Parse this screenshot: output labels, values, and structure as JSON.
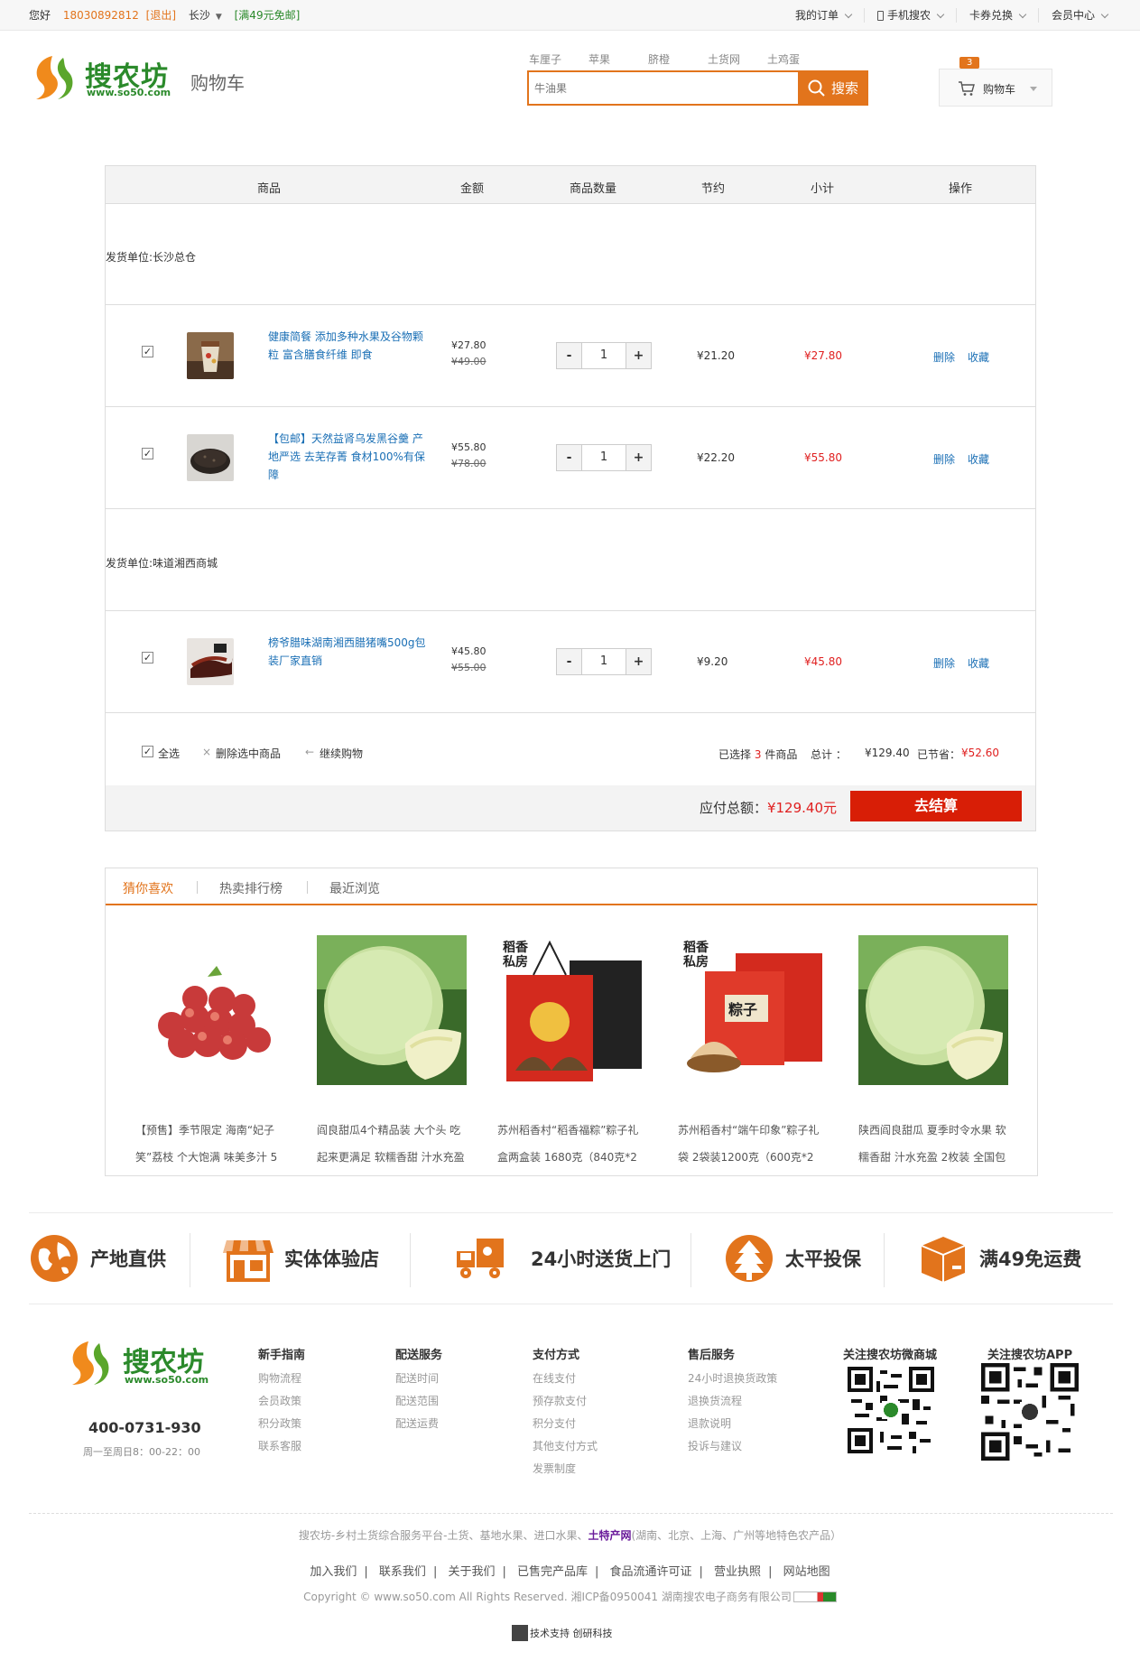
{
  "topbar": {
    "greeting": "您好",
    "phone": "18030892812",
    "logout": "[退出]",
    "city": "长沙",
    "promo": "[满49元免邮]",
    "menu": [
      "我的订单",
      "手机搜农",
      "卡券兑换",
      "会员中心"
    ]
  },
  "header": {
    "brand": "搜农坊",
    "brand_url": "www.so50.com",
    "page_name": "购物车",
    "hot_words": [
      "车厘子",
      "苹果",
      "脐橙",
      "土货网",
      "土鸡蛋"
    ],
    "search_placeholder": "牛油果",
    "search_button": "搜索",
    "cart_count": "3",
    "cart_label": "购物车"
  },
  "cart": {
    "columns": [
      "商品",
      "金额",
      "商品数量",
      "节约",
      "小计",
      "操作"
    ],
    "shops": [
      {
        "label": "发货单位:长沙总仓"
      },
      {
        "label": "发货单位:味道湘西商城"
      }
    ],
    "items": [
      {
        "checked": "✓",
        "name": "健康简餐 添加多种水果及谷物颗粒 富含膳食纤维 即食",
        "price": "¥27.80",
        "orig_price": "¥49.00",
        "qty": "1",
        "save": "¥21.20",
        "subtotal": "¥27.80",
        "op_delete": "删除",
        "op_fav": "收藏"
      },
      {
        "checked": "✓",
        "name": "【包邮】天然益肾乌发黑谷羹 产地严选 去芜存菁 食材100%有保障",
        "price": "¥55.80",
        "orig_price": "¥78.00",
        "qty": "1",
        "save": "¥22.20",
        "subtotal": "¥55.80",
        "op_delete": "删除",
        "op_fav": "收藏"
      },
      {
        "checked": "✓",
        "name": "榜爷腊味湖南湘西腊猪嘴500g包装厂家直销",
        "price": "¥45.80",
        "orig_price": "¥55.00",
        "qty": "1",
        "save": "¥9.20",
        "subtotal": "¥45.80",
        "op_delete": "删除",
        "op_fav": "收藏"
      }
    ],
    "qty_minus": "-",
    "qty_plus": "+",
    "select_all": "全选",
    "delete_selected": "删除选中商品",
    "continue_shopping": "继续购物",
    "selected_prefix": "已选择",
    "selected_count": "3",
    "selected_suffix": "件商品",
    "total_label": "总计 ：",
    "total": "¥129.40",
    "saved_label": "已节省：",
    "saved": "¥52.60",
    "payable_label": "应付总额：",
    "payable": "¥129.40元",
    "checkout": "去结算"
  },
  "recommend": {
    "tabs": [
      "猜你喜欢",
      "热卖排行榜",
      "最近浏览"
    ],
    "items": [
      {
        "title": "【预售】季节限定 海南“妃子笑”荔枝 个大饱满 味美多汁 5"
      },
      {
        "title": "阎良甜瓜4个精品装 大个头 吃起来更满足 软糯香甜 汁水充盈"
      },
      {
        "title": "苏州稻香村“稻香福粽”粽子礼盒两盒装 1680克（840克*2"
      },
      {
        "title": "苏州稻香村“端午印象”粽子礼袋 2袋装1200克（600克*2"
      },
      {
        "title": "陕西阎良甜瓜 夏季时令水果 软糯香甜 汁水充盈 2枚装 全国包"
      }
    ]
  },
  "features": [
    "产地直供",
    "实体体验店",
    "24小时送货上门",
    "太平投保",
    "满49免运费"
  ],
  "footer": {
    "phone": "400-0731-930",
    "hours": "周一至周日8：00-22：00",
    "columns": [
      {
        "title": "新手指南",
        "items": [
          "购物流程",
          "会员政策",
          "积分政策",
          "联系客服"
        ]
      },
      {
        "title": "配送服务",
        "items": [
          "配送时间",
          "配送范围",
          "配送运费"
        ]
      },
      {
        "title": "支付方式",
        "items": [
          "在线支付",
          "预存款支付",
          "积分支付",
          "其他支付方式",
          "发票制度"
        ]
      },
      {
        "title": "售后服务",
        "items": [
          "24小时退换货政策",
          "退换货流程",
          "退款说明",
          "投诉与建议"
        ]
      }
    ],
    "qr_labels": [
      "关注搜农坊微商城",
      "关注搜农坊APP"
    ],
    "about_pre": "搜农坊-乡村土货综合服务平台-土货、基地水果、进口水果、",
    "about_bold": "土特产网",
    "about_post": "(湖南、北京、上海、广州等地特色农产品）",
    "links": [
      "加入我们",
      "联系我们",
      "关于我们",
      "已售完产品库",
      "食品流通许可证",
      "营业执照",
      "网站地图"
    ],
    "copyright": "Copyright © www.so50.com All Rights Reserved. 湘ICP备0950041 湖南搜农电子商务有限公司",
    "tech": "技术支持 创研科技"
  },
  "colors": {
    "accent": "#e2741c",
    "price_red": "#e02020",
    "link_blue": "#1a6fb5",
    "brand_green": "#2b8a2b",
    "checkout_red": "#d81e06"
  }
}
